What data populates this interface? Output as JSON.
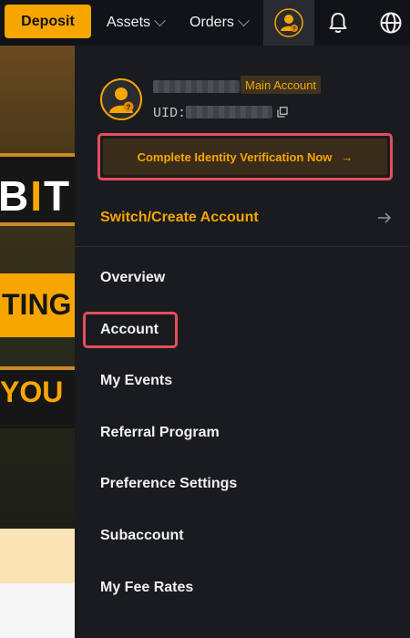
{
  "topbar": {
    "deposit_label": "Deposit",
    "assets_label": "Assets",
    "orders_label": "Orders",
    "icons": [
      "user-avatar-icon",
      "bell-icon",
      "globe-icon"
    ]
  },
  "banner": {
    "text_bit_prefix": "B",
    "text_bit_i": "I",
    "text_bit_suffix": "T",
    "text_ting": "TING",
    "text_you": "YOU"
  },
  "profile": {
    "badge": "Main Account",
    "uid_label": "UID:",
    "verify_label": "Complete Identity Verification Now",
    "verify_arrow": "→",
    "switch_label": "Switch/Create Account",
    "switch_arrow": "→"
  },
  "menu": {
    "overview": "Overview",
    "account": "Account",
    "events": "My Events",
    "referral": "Referral Program",
    "preferences": "Preference Settings",
    "subaccount": "Subaccount",
    "fee_rates": "My Fee Rates"
  },
  "colors": {
    "accent": "#f7a600",
    "highlight": "#e64d5c",
    "panel": "#1a1b1f",
    "topbar": "#121318"
  }
}
